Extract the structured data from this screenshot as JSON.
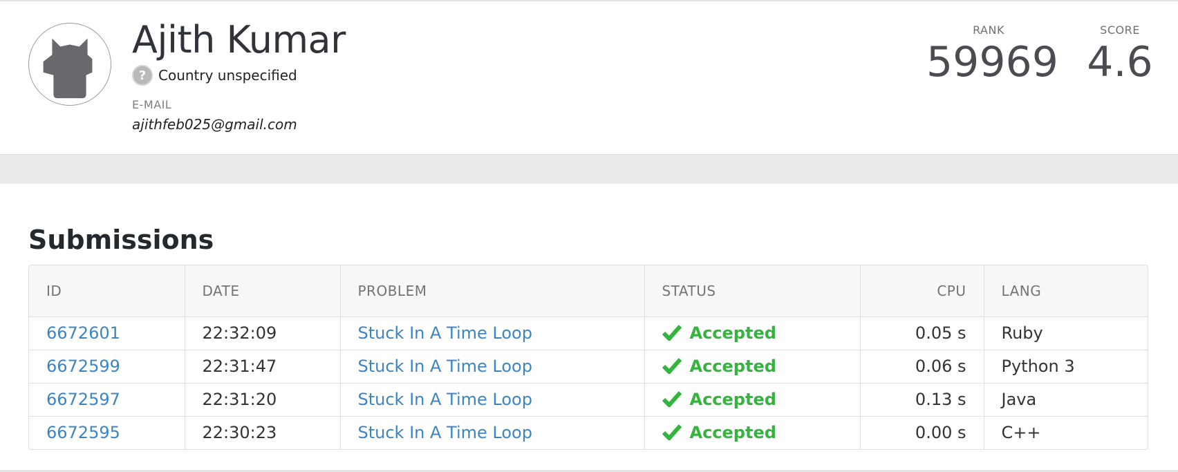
{
  "profile": {
    "name": "Ajith Kumar",
    "country": "Country unspecified",
    "country_icon": "?",
    "email_label": "E-MAIL",
    "email": "ajithfeb025@gmail.com",
    "rank_label": "RANK",
    "rank": "59969",
    "score_label": "SCORE",
    "score": "4.6"
  },
  "submissions": {
    "title": "Submissions",
    "columns": {
      "id": "ID",
      "date": "DATE",
      "problem": "PROBLEM",
      "status": "STATUS",
      "cpu": "CPU",
      "lang": "LANG"
    },
    "rows": [
      {
        "id": "6672601",
        "date": "22:32:09",
        "problem": "Stuck In A Time Loop",
        "status": "Accepted",
        "cpu": "0.05 s",
        "lang": "Ruby"
      },
      {
        "id": "6672599",
        "date": "22:31:47",
        "problem": "Stuck In A Time Loop",
        "status": "Accepted",
        "cpu": "0.06 s",
        "lang": "Python 3"
      },
      {
        "id": "6672597",
        "date": "22:31:20",
        "problem": "Stuck In A Time Loop",
        "status": "Accepted",
        "cpu": "0.13 s",
        "lang": "Java"
      },
      {
        "id": "6672595",
        "date": "22:30:23",
        "problem": "Stuck In A Time Loop",
        "status": "Accepted",
        "cpu": "0.00 s",
        "lang": "C++"
      }
    ]
  },
  "colors": {
    "link": "#3b85c4",
    "accepted": "#35b33f",
    "header_bg": "#f6f7f8"
  },
  "icons": {
    "avatar": "cat-silhouette-avatar-icon",
    "country": "question-mark-icon",
    "status": "check-icon"
  }
}
